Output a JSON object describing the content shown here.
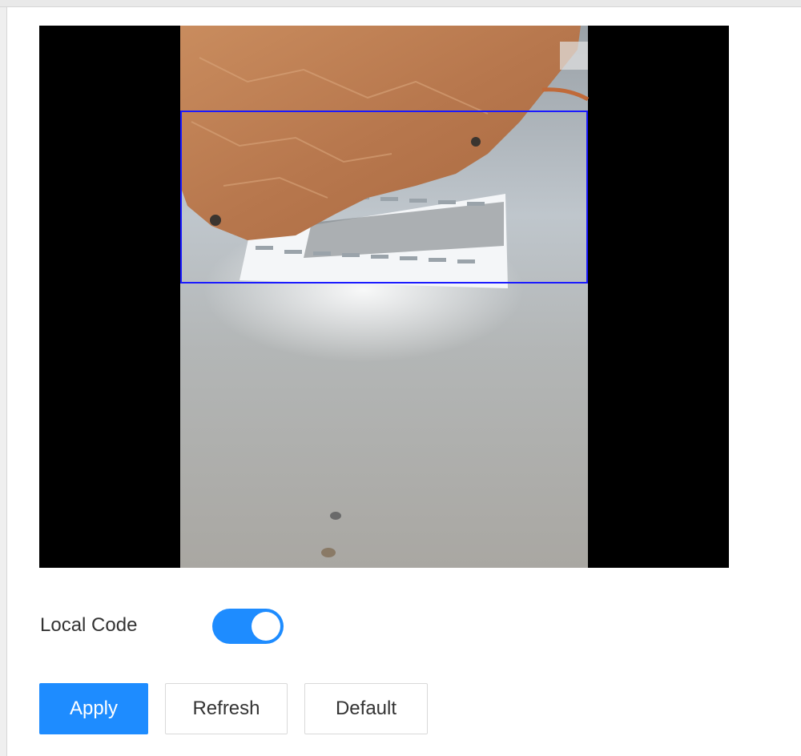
{
  "video": {
    "description_icon": "camera-preview",
    "region_color": "#1a1aff"
  },
  "settings": {
    "local_code_label": "Local Code",
    "local_code_enabled": true
  },
  "actions": {
    "apply_label": "Apply",
    "refresh_label": "Refresh",
    "default_label": "Default"
  },
  "colors": {
    "accent": "#1e8cff",
    "button_border": "#d9d9d9",
    "text": "#333333"
  }
}
